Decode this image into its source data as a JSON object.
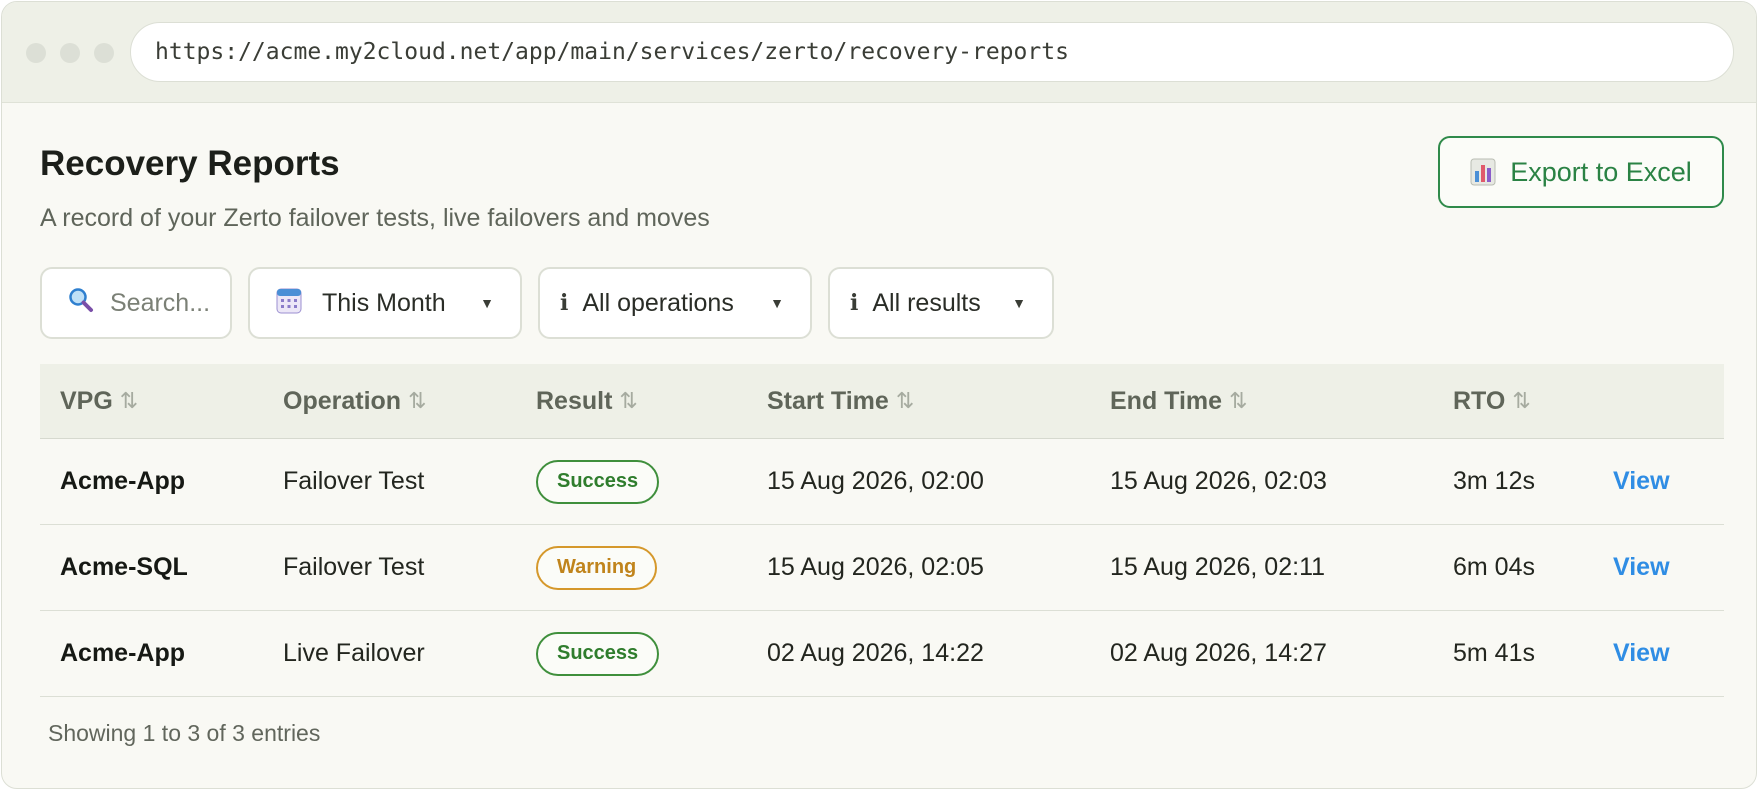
{
  "browser": {
    "url": "https://acme.my2cloud.net/app/main/services/zerto/recovery-reports"
  },
  "page": {
    "title": "Recovery Reports",
    "subtitle": "A record of your Zerto failover tests, live failovers and moves",
    "export_label": "Export to Excel"
  },
  "filters": {
    "search_placeholder": "Search...",
    "period": "This Month",
    "operations": "All operations",
    "results": "All results"
  },
  "table": {
    "columns": [
      "VPG",
      "Operation",
      "Result",
      "Start Time",
      "End Time",
      "RTO"
    ],
    "rows": [
      {
        "vpg": "Acme-App",
        "operation": "Failover Test",
        "result": "Success",
        "start": "15 Aug 2026, 02:00",
        "end": "15 Aug 2026, 02:03",
        "rto": "3m 12s",
        "action": "View"
      },
      {
        "vpg": "Acme-SQL",
        "operation": "Failover Test",
        "result": "Warning",
        "start": "15 Aug 2026, 02:05",
        "end": "15 Aug 2026, 02:11",
        "rto": "6m 04s",
        "action": "View"
      },
      {
        "vpg": "Acme-App",
        "operation": "Live Failover",
        "result": "Success",
        "start": "02 Aug 2026, 14:22",
        "end": "02 Aug 2026, 14:27",
        "rto": "5m 41s",
        "action": "View"
      }
    ],
    "footer": "Showing 1 to 3 of 3 entries"
  },
  "colors": {
    "success": "#2f7d2d",
    "warning": "#c0841c",
    "link": "#2f8de4",
    "export": "#2a8244"
  },
  "icons": {
    "search": "magnifier-icon",
    "calendar": "calendar-icon",
    "info": "info-icon",
    "export": "excel-icon",
    "sort": "sort-icon",
    "caret": "caret-down-icon"
  }
}
